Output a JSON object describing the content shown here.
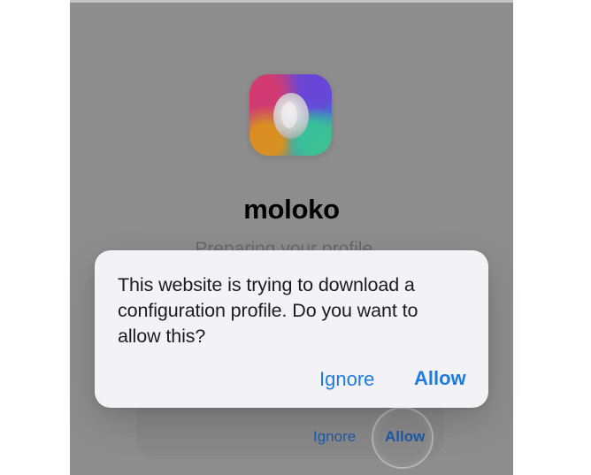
{
  "app": {
    "name": "moloko",
    "subtitle": "Preparing your profile..."
  },
  "background_buttons": {
    "ignore_label": "Ignore",
    "allow_label": "Allow"
  },
  "dialog": {
    "message": "This website is trying to download a configuration profile. Do you want to allow this?",
    "ignore_label": "Ignore",
    "allow_label": "Allow"
  },
  "colors": {
    "background_dim": "#959595",
    "dialog_background": "#f2f2f7",
    "accent": "#1e7be0",
    "text_primary": "#1c1c1e"
  },
  "icons": {
    "app_icon": "moloko-app-icon"
  }
}
